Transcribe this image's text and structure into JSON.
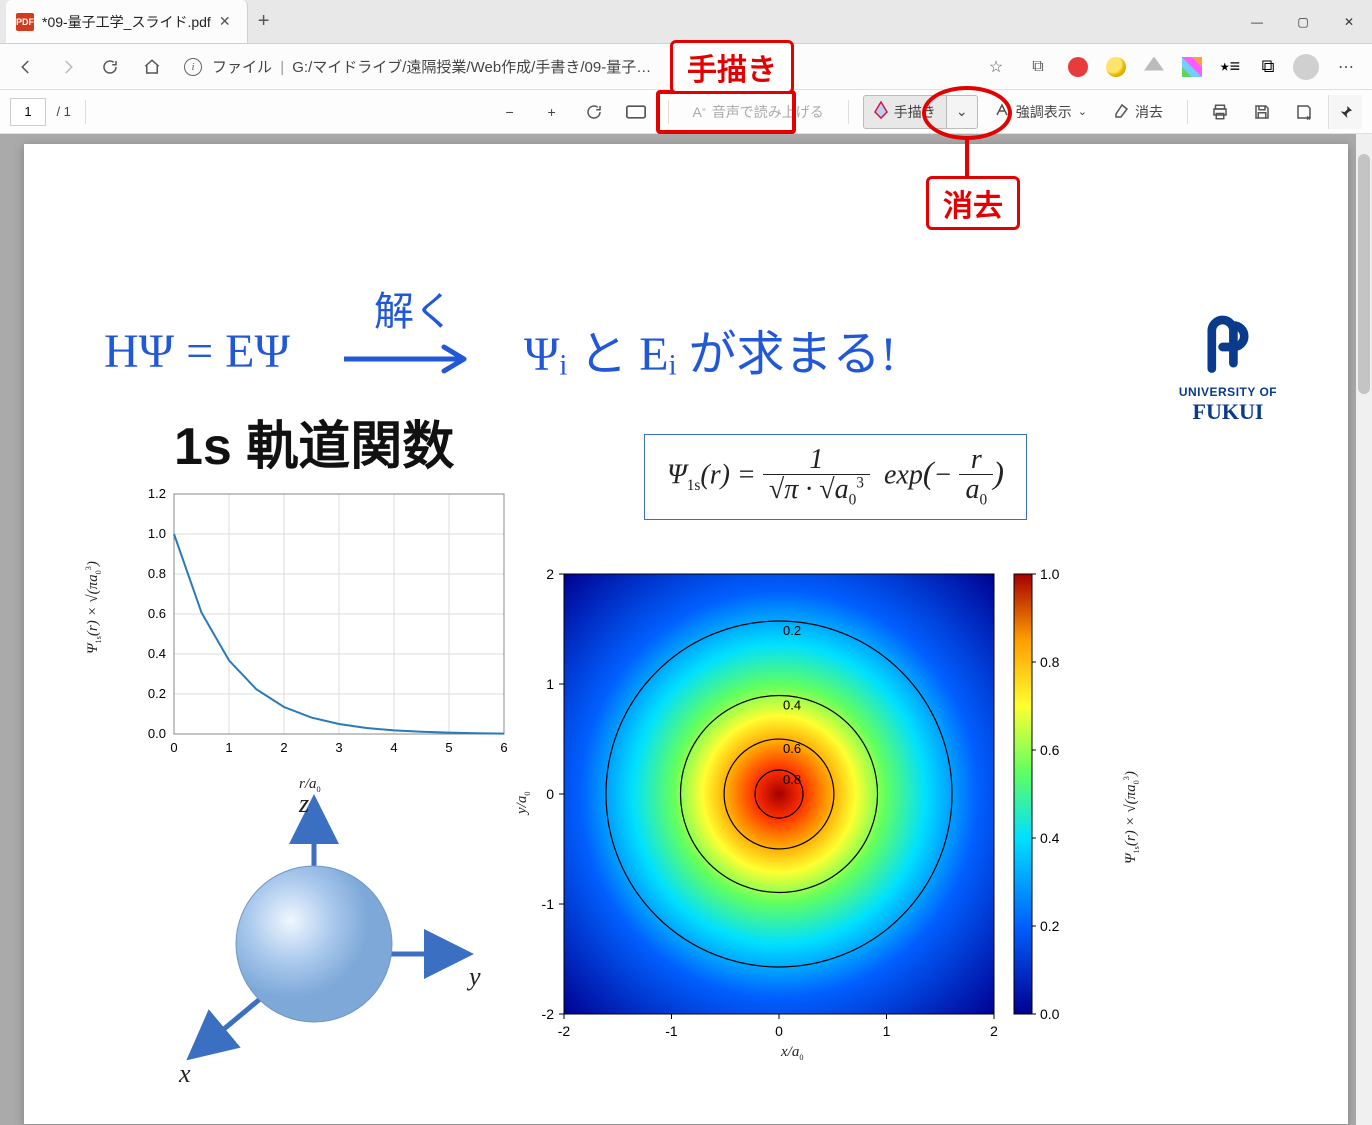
{
  "window": {
    "tab_title": "*09-量子工学_スライド.pdf",
    "minimize": "—",
    "maximize": "▢",
    "close": "✕",
    "newtab": "+"
  },
  "address": {
    "scheme_label": "ファイル",
    "path": "G:/マイドライブ/遠隔授業/Web作成/手書き/09-量子…",
    "back": "←",
    "fwd": "→",
    "reload": "⟳",
    "home": "⌂",
    "fav": "☆",
    "collections": "⧉",
    "menu": "⋯"
  },
  "pdf_toolbar": {
    "page_current": "1",
    "page_total": "/ 1",
    "zoom_out": "−",
    "zoom_in": "+",
    "rotate": "↻",
    "fit": "▭",
    "tts_label": "音声で読み上げる",
    "draw_label": "手描き",
    "draw_chev": "⌄",
    "highlight_label": "強調表示",
    "erase_label": "消去",
    "print": "🖨",
    "save": "💾",
    "saveas": "⤓",
    "pin": "📌"
  },
  "callouts": {
    "draw": "手描き",
    "erase": "消去"
  },
  "slide": {
    "title": "1s 軌道関数",
    "uni1": "UNIVERSITY OF",
    "uni2": "FUKUI",
    "equation_html": "Ψ<span class='sub'>1s</span>(r) = 1 / (√π · √a<span class='sub'>0</span><span class='sup'>3</span>) · exp(− r / a<span class='sub'>0</span>)",
    "ink_eq": "HΨ = EΨ",
    "ink_arrow_top": "解く",
    "ink_right": "Ψᵢ と Eᵢ が求まる!",
    "axes_3d": {
      "x": "x",
      "y": "y",
      "z": "z"
    }
  },
  "chart_data": [
    {
      "type": "line",
      "title": "",
      "xlabel": "r/a0",
      "ylabel": "Ψ1s(r) × √(πa0³)",
      "xlim": [
        0,
        6
      ],
      "ylim": [
        0,
        1.2
      ],
      "xticks": [
        0,
        1,
        2,
        3,
        4,
        5,
        6
      ],
      "yticks": [
        0.0,
        0.2,
        0.4,
        0.6,
        0.8,
        1.0,
        1.2
      ],
      "series": [
        {
          "name": "Ψ1s",
          "x": [
            0,
            0.5,
            1,
            1.5,
            2,
            2.5,
            3,
            3.5,
            4,
            4.5,
            5,
            5.5,
            6
          ],
          "y": [
            1.0,
            0.607,
            0.368,
            0.223,
            0.135,
            0.082,
            0.05,
            0.03,
            0.018,
            0.011,
            0.007,
            0.004,
            0.002
          ]
        }
      ]
    },
    {
      "type": "heatmap",
      "title": "",
      "xlabel": "x/a0",
      "ylabel": "y/a0",
      "clabel": "Ψ1s(r) × √(πa0³)",
      "xlim": [
        -2,
        2
      ],
      "ylim": [
        -2,
        2
      ],
      "clim": [
        0.0,
        1.0
      ],
      "xticks": [
        -2,
        -1,
        0,
        1,
        2
      ],
      "yticks": [
        -2,
        -1,
        0,
        1,
        2
      ],
      "cticks": [
        0.0,
        0.2,
        0.4,
        0.6,
        0.8,
        1.0
      ],
      "contours": [
        0.2,
        0.4,
        0.6,
        0.8
      ],
      "colormap": "jet"
    }
  ]
}
